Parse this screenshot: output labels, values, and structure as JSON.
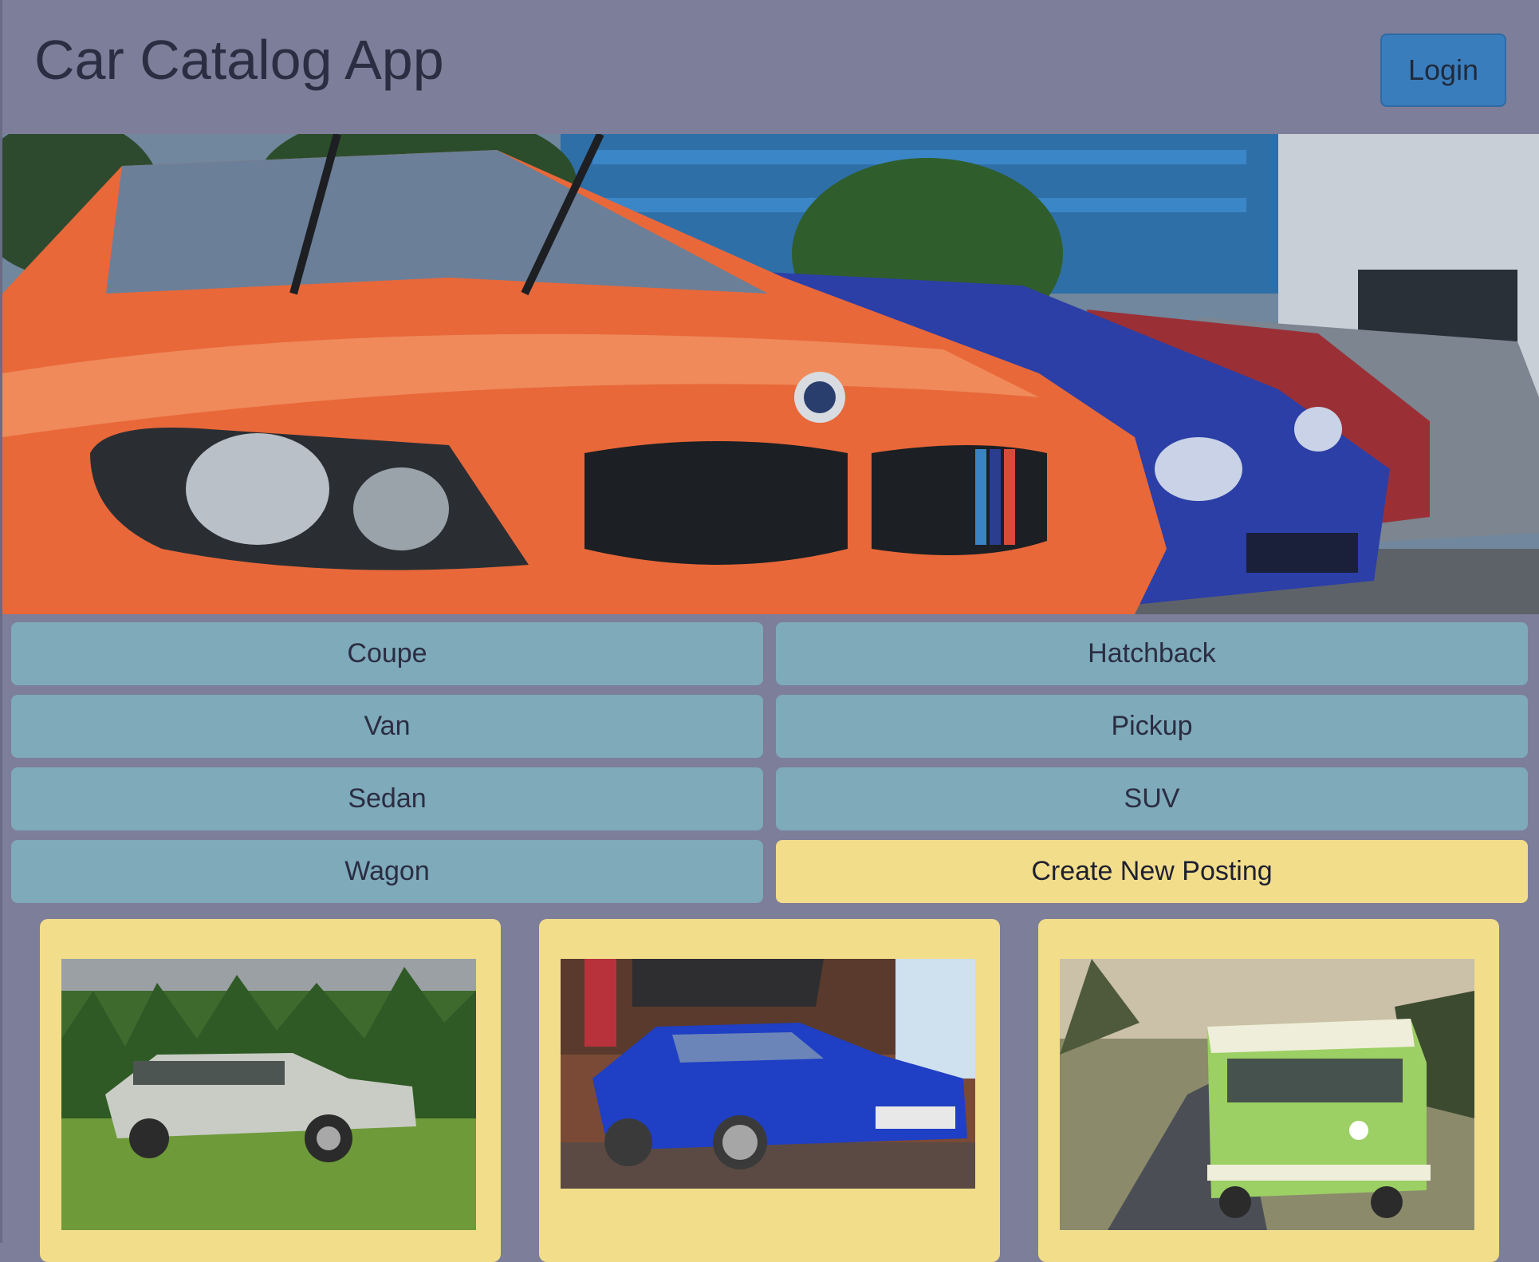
{
  "app": {
    "title": "Car Catalog App"
  },
  "header": {
    "login_label": "Login"
  },
  "hero": {
    "alt": "BMW hero"
  },
  "categories": [
    {
      "label": "Coupe"
    },
    {
      "label": "Hatchback"
    },
    {
      "label": "Van"
    },
    {
      "label": "Pickup"
    },
    {
      "label": "Sedan"
    },
    {
      "label": "SUV"
    },
    {
      "label": "Wagon"
    }
  ],
  "create_label": "Create New Posting",
  "listings": [
    {
      "title": ""
    },
    {
      "title": ""
    },
    {
      "title": ""
    }
  ],
  "colors": {
    "background": "#7d7e99",
    "category_button": "#7eaaba",
    "create_button": "#f2dd8b",
    "card": "#f2dd8b",
    "login_button": "#3a7dbd"
  }
}
